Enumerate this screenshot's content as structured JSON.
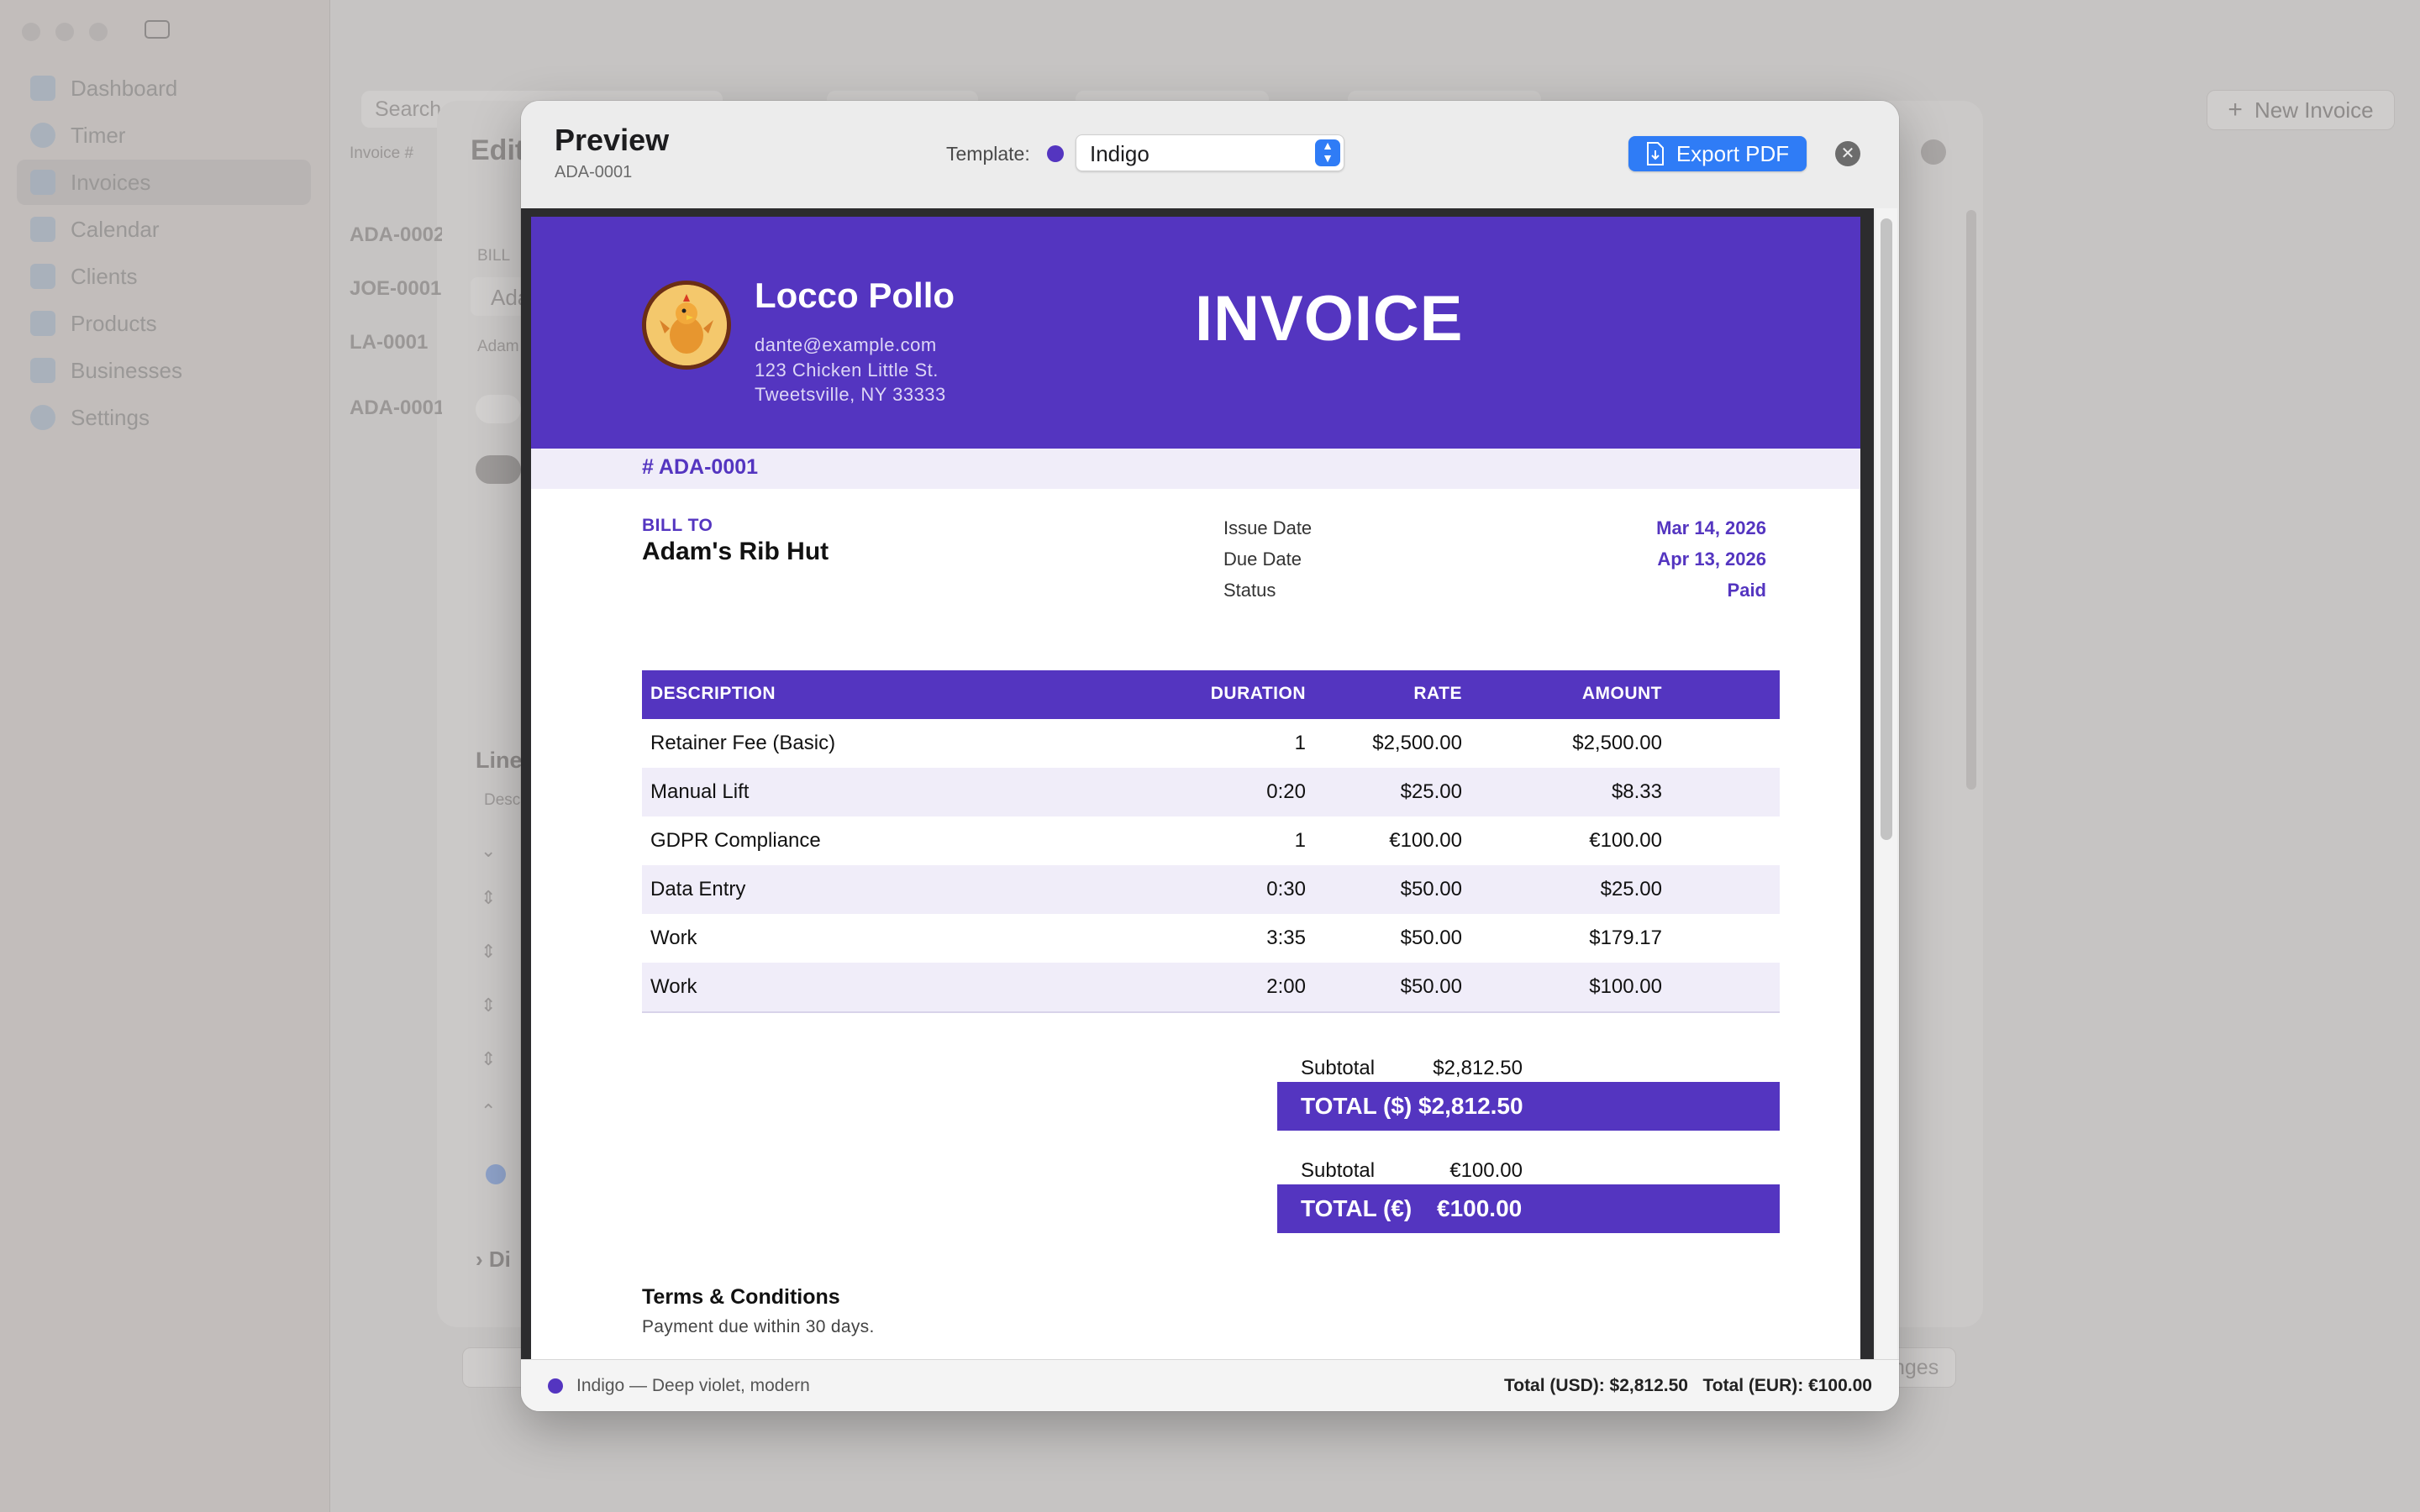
{
  "background": {
    "sidebar": [
      {
        "label": "Dashboard",
        "selected": false
      },
      {
        "label": "Timer",
        "selected": false
      },
      {
        "label": "Invoices",
        "selected": true
      },
      {
        "label": "Calendar",
        "selected": false
      },
      {
        "label": "Clients",
        "selected": false
      },
      {
        "label": "Products",
        "selected": false
      },
      {
        "label": "Businesses",
        "selected": false
      },
      {
        "label": "Settings",
        "selected": false
      }
    ],
    "search_placeholder": "Search",
    "new_invoice_label": "New Invoice",
    "edit_title_fragment": "Edit",
    "list_header": "Invoice #",
    "list_items": [
      "ADA-0002",
      "JOE-0001",
      "LA-0001",
      "ADA-0001"
    ],
    "bill_fragment": "BILL",
    "client_fragment": "Ada",
    "client_sub_fragment": "Adam",
    "lines_fragment": "Line",
    "desc_fragment": "Desc",
    "disc_fragment": "Di",
    "changes_fragment": "nges"
  },
  "modal": {
    "title": "Preview",
    "subtitle": "ADA-0001",
    "template_label": "Template:",
    "template_value": "Indigo",
    "template_color": "#5435c0",
    "export_label": "Export PDF",
    "footer_template": "Indigo — Deep violet, modern",
    "footer_totals": "Total (USD): $2,812.50   Total (EUR): €100.00"
  },
  "invoice": {
    "business_name": "Locco Pollo",
    "email": "dante@example.com",
    "address1": "123 Chicken Little St.",
    "address2": "Tweetsville, NY 33333",
    "heading": "INVOICE",
    "number": "# ADA-0001",
    "bill_to_label": "BILL TO",
    "bill_to_name": "Adam's Rib Hut",
    "issue_label": "Issue Date",
    "issue_value": "Mar 14, 2026",
    "due_label": "Due Date",
    "due_value": "Apr 13, 2026",
    "status_label": "Status",
    "status_value": "Paid",
    "columns": {
      "description": "DESCRIPTION",
      "duration": "DURATION",
      "rate": "RATE",
      "amount": "AMOUNT"
    },
    "rows": [
      {
        "description": "Retainer Fee (Basic)",
        "duration": "1",
        "rate": "$2,500.00",
        "amount": "$2,500.00"
      },
      {
        "description": "Manual Lift",
        "duration": "0:20",
        "rate": "$25.00",
        "amount": "$8.33"
      },
      {
        "description": "GDPR Compliance",
        "duration": "1",
        "rate": "€100.00",
        "amount": "€100.00"
      },
      {
        "description": "Data Entry",
        "duration": "0:30",
        "rate": "$50.00",
        "amount": "$25.00"
      },
      {
        "description": "Work",
        "duration": "3:35",
        "rate": "$50.00",
        "amount": "$179.17"
      },
      {
        "description": "Work",
        "duration": "2:00",
        "rate": "$50.00",
        "amount": "$100.00"
      }
    ],
    "totals": [
      {
        "subtotal_label": "Subtotal",
        "subtotal_value": "$2,812.50",
        "total_label": "TOTAL ($)",
        "total_value": "$2,812.50"
      },
      {
        "subtotal_label": "Subtotal",
        "subtotal_value": "€100.00",
        "total_label": "TOTAL (€)",
        "total_value": "€100.00"
      }
    ],
    "terms_title": "Terms & Conditions",
    "terms_body": "Payment due within 30 days."
  }
}
